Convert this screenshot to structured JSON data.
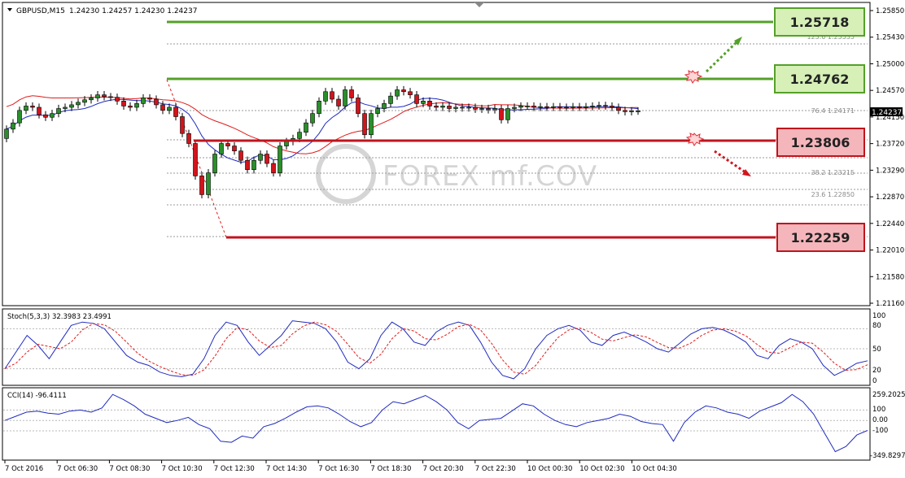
{
  "header": {
    "symbol": "GBPUSD,M15",
    "ohlc": "1.24230 1.24257 1.24230 1.24237"
  },
  "price_axis": {
    "ticks": [
      "1.25850",
      "1.25430",
      "1.25000",
      "1.24570",
      "1.24150",
      "1.23720",
      "1.23290",
      "1.22870",
      "1.22440",
      "1.22010",
      "1.21580",
      "1.21160"
    ],
    "current_price": "1.24237"
  },
  "time_axis": {
    "ticks": [
      "7 Oct 2016",
      "7 Oct 06:30",
      "7 Oct 08:30",
      "7 Oct 10:30",
      "7 Oct 12:30",
      "7 Oct 14:30",
      "7 Oct 16:30",
      "7 Oct 18:30",
      "7 Oct 20:30",
      "7 Oct 22:30",
      "10 Oct 00:30",
      "10 Oct 02:30",
      "10 Oct 04:30"
    ]
  },
  "levels": [
    {
      "name": "resistance-2",
      "value": "1.25718",
      "color": "#55a02a",
      "label_bg": "#d6f0b8"
    },
    {
      "name": "resistance-1",
      "value": "1.24762",
      "color": "#55a02a",
      "label_bg": "#d6f0b8"
    },
    {
      "name": "support-1",
      "value": "1.23806",
      "color": "#c0141c",
      "label_bg": "#f4b6bb"
    },
    {
      "name": "support-2",
      "value": "1.22259",
      "color": "#c0141c",
      "label_bg": "#f4b6bb"
    }
  ],
  "fib_labels": [
    {
      "text": "123.6  1.25535",
      "price": 1.25535
    },
    {
      "text": "76.4  1.24171",
      "price": 1.24171
    },
    {
      "text": "38.2  1.23215",
      "price": 1.23215
    },
    {
      "text": "23.6  1.22850",
      "price": 1.2285
    }
  ],
  "watermark": "FOREX mf.COV",
  "stoch": {
    "title": "Stoch(5,3,3) 32.3983 23.4991",
    "ticks": [
      "100",
      "80",
      "50",
      "20",
      "0"
    ]
  },
  "cci": {
    "title": "CCI(14) -96.4111",
    "ticks": [
      "259.2025",
      "100",
      "0.00",
      "-100",
      "-349.8297"
    ]
  },
  "chart_data": {
    "type": "candlestick",
    "symbol": "GBPUSD",
    "timeframe": "M15",
    "ylim": [
      1.2116,
      1.2585
    ],
    "horizontal_levels": [
      1.25718,
      1.24762,
      1.23806,
      1.22259
    ],
    "fibonacci": {
      "123.6": 1.25535,
      "76.4": 1.24171,
      "38.2": 1.23215,
      "23.6": 1.2285
    },
    "last_price": 1.24237,
    "series": [
      {
        "name": "Stoch(5,3,3)",
        "values": [
          32.3983,
          23.4991
        ]
      },
      {
        "name": "CCI(14)",
        "values": [
          -96.4111
        ]
      }
    ],
    "candles_close_approx": [
      1.2395,
      1.2405,
      1.2425,
      1.2432,
      1.243,
      1.2418,
      1.2414,
      1.242,
      1.2428,
      1.243,
      1.2434,
      1.2438,
      1.2442,
      1.2445,
      1.245,
      1.2447,
      1.2446,
      1.244,
      1.2432,
      1.243,
      1.2436,
      1.2445,
      1.2443,
      1.2434,
      1.2425,
      1.243,
      1.2415,
      1.2388,
      1.2372,
      1.232,
      1.229,
      1.2325,
      1.2355,
      1.2372,
      1.2368,
      1.236,
      1.2345,
      1.233,
      1.2345,
      1.2355,
      1.234,
      1.2325,
      1.2368,
      1.2375,
      1.238,
      1.239,
      1.2405,
      1.242,
      1.244,
      1.2455,
      1.2443,
      1.2432,
      1.2458,
      1.2445,
      1.242,
      1.2386,
      1.242,
      1.2428,
      1.2436,
      1.2448,
      1.2458,
      1.2455,
      1.245,
      1.2436,
      1.244,
      1.2432,
      1.243,
      1.2432,
      1.2428,
      1.243,
      1.2429,
      1.243,
      1.2427,
      1.2428,
      1.2426,
      1.2428,
      1.241,
      1.2428,
      1.243,
      1.2432,
      1.2432,
      1.243,
      1.2431,
      1.243,
      1.2431,
      1.243,
      1.243,
      1.2431,
      1.243,
      1.2431,
      1.2432,
      1.2433,
      1.2432,
      1.243,
      1.2425,
      1.2423,
      1.2424,
      1.2424
    ]
  }
}
